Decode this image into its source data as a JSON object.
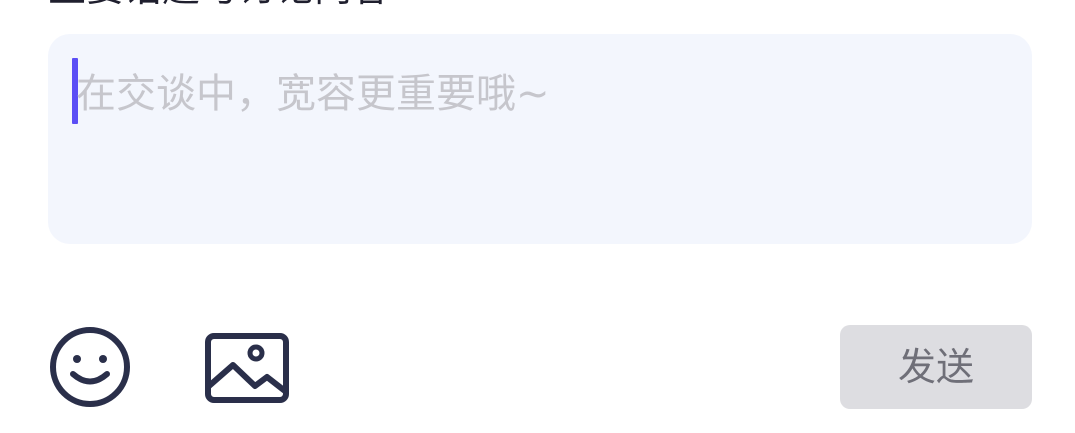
{
  "header": {
    "title": "主要话题与讨论内容"
  },
  "comment_input": {
    "placeholder": "在交谈中，宽容更重要哦~",
    "value": "",
    "caret_color": "#5b4ef5",
    "background": "#f3f6fd"
  },
  "toolbar": {
    "emoji_icon": "smiley-face-icon",
    "image_icon": "image-picture-icon",
    "send_label": "发送",
    "send_enabled": false,
    "icon_color": "#2a2f4a"
  }
}
